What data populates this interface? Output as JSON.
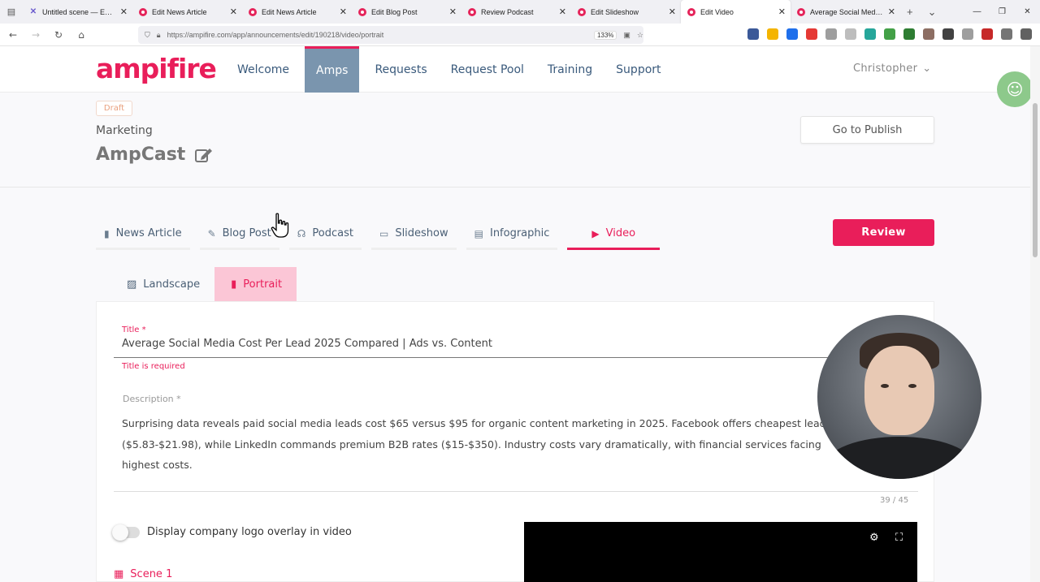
{
  "browser": {
    "tabs": [
      {
        "title": "Untitled scene — Excalidraw",
        "icon": "excalidraw-icon",
        "active": false
      },
      {
        "title": "Edit News Article",
        "icon": "ampifire-icon",
        "active": false
      },
      {
        "title": "Edit News Article",
        "icon": "ampifire-icon",
        "active": false
      },
      {
        "title": "Edit Blog Post",
        "icon": "ampifire-icon",
        "active": false
      },
      {
        "title": "Review Podcast",
        "icon": "ampifire-icon",
        "active": false
      },
      {
        "title": "Edit Slideshow",
        "icon": "ampifire-icon",
        "active": false
      },
      {
        "title": "Edit Video",
        "icon": "ampifire-icon",
        "active": true
      },
      {
        "title": "Average Social Media Cost",
        "icon": "ampifire-icon",
        "active": false
      }
    ],
    "url": "https://ampifire.com/app/announcements/edit/190218/video/portrait",
    "zoom": "133%"
  },
  "header": {
    "logo": "ampifire",
    "nav": [
      {
        "label": "Welcome",
        "active": false
      },
      {
        "label": "Amps",
        "active": true
      },
      {
        "label": "Requests",
        "active": false
      },
      {
        "label": "Request Pool",
        "active": false
      },
      {
        "label": "Training",
        "active": false
      },
      {
        "label": "Support",
        "active": false
      }
    ],
    "user": "Christopher"
  },
  "project": {
    "status": "Draft",
    "category": "Marketing",
    "title": "AmpCast",
    "publish_label": "Go to Publish",
    "review_label": "Review"
  },
  "content_tabs": [
    {
      "label": "News Article",
      "icon": "document-icon"
    },
    {
      "label": "Blog Post",
      "icon": "edit-icon"
    },
    {
      "label": "Podcast",
      "icon": "headphones-icon"
    },
    {
      "label": "Slideshow",
      "icon": "monitor-icon"
    },
    {
      "label": "Infographic",
      "icon": "chart-file-icon"
    },
    {
      "label": "Video",
      "icon": "play-circle-icon"
    }
  ],
  "orientation_tabs": [
    {
      "label": "Landscape",
      "icon": "image-icon"
    },
    {
      "label": "Portrait",
      "icon": "portrait-icon"
    }
  ],
  "form": {
    "title_label": "Title *",
    "title_value": "Average Social Media Cost Per Lead 2025 Compared | Ads vs. Content",
    "title_error": "Title is required",
    "description_label": "Description *",
    "description_value": "Surprising data reveals paid social media leads cost $65 versus $95 for organic content marketing in 2025. Facebook offers cheapest leads ($5.83-$21.98), while LinkedIn commands premium B2B rates ($15-$350). Industry costs vary dramatically, with financial services facing highest costs.",
    "counter": "39 / 45",
    "logo_overlay_label": "Display company logo overlay in video",
    "logo_overlay_enabled": false,
    "scene_label": "Scene 1"
  },
  "colors": {
    "brand": "#e91e5a",
    "nav_active": "#7a95ae",
    "portrait_active_bg": "#fbc6d6"
  }
}
